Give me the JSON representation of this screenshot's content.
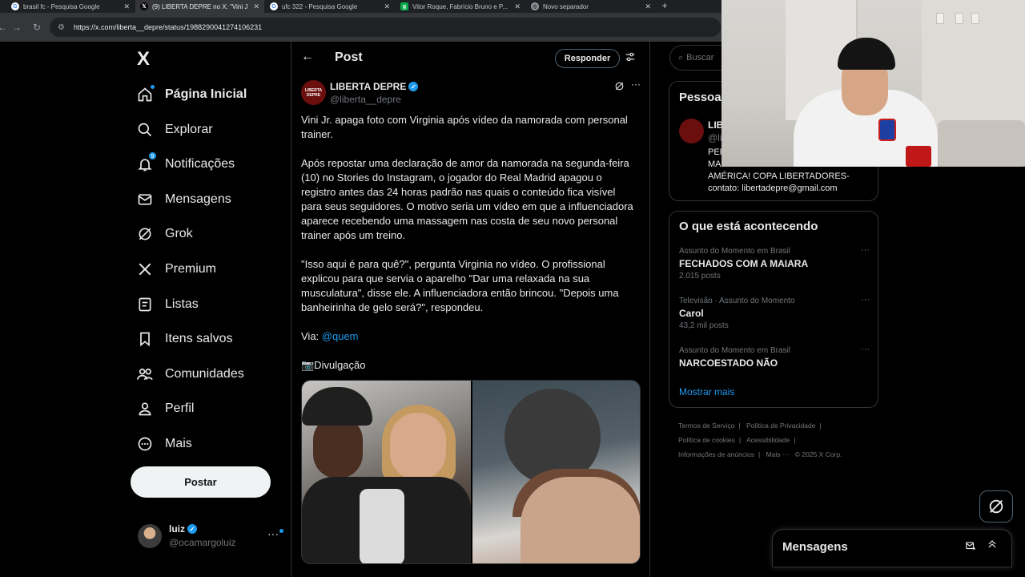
{
  "browser": {
    "tabs": [
      {
        "label": "brasil fc - Pesquisa Google",
        "icon": "google-icon",
        "active": false
      },
      {
        "label": "(9) LIBERTA DEPRE no X: \"Vini J...",
        "icon": "x-icon",
        "active": true
      },
      {
        "label": "ufc 322 - Pesquisa Google",
        "icon": "google-icon",
        "active": false
      },
      {
        "label": "Vitor Roque, Fabrício Bruno e P...",
        "icon": "ge-icon",
        "active": false
      },
      {
        "label": "Novo separador",
        "icon": "chrome-icon",
        "active": false
      }
    ],
    "new_tab": "+",
    "url": "https://x.com/liberta__depre/status/1988290041274106231"
  },
  "nav": {
    "logo": "X",
    "items": [
      {
        "label": "Página Inicial",
        "icon": "home-icon"
      },
      {
        "label": "Explorar",
        "icon": "search-icon"
      },
      {
        "label": "Notificações",
        "icon": "bell-icon",
        "badge": "9"
      },
      {
        "label": "Mensagens",
        "icon": "mail-icon"
      },
      {
        "label": "Grok",
        "icon": "grok-icon"
      },
      {
        "label": "Premium",
        "icon": "x-premium-icon"
      },
      {
        "label": "Listas",
        "icon": "list-icon"
      },
      {
        "label": "Itens salvos",
        "icon": "bookmark-icon"
      },
      {
        "label": "Comunidades",
        "icon": "communities-icon"
      },
      {
        "label": "Perfil",
        "icon": "person-icon"
      },
      {
        "label": "Mais",
        "icon": "more-circle-icon"
      }
    ],
    "post_button": "Postar"
  },
  "account": {
    "name": "luiz",
    "handle": "@ocamargoluiz",
    "more": "···"
  },
  "post": {
    "header_title": "Post",
    "reply_button": "Responder",
    "author_name": "LIBERTA DEPRE",
    "author_handle": "@liberta__depre",
    "avatar_text": "LIBERTA DEPRE",
    "paragraphs": [
      "Vini Jr. apaga foto com Virginia após vídeo da namorada com personal trainer.",
      "Após repostar uma declaração de amor da namorada na segunda-feira (10) no Stories do Instagram, o jogador do Real Madrid apagou o registro antes das 24 horas padrão nas quais o conteúdo fica visível para seus seguidores. O motivo seria um vídeo em que a influenciadora aparece recebendo uma massagem nas costa de seu novo personal trainer após um treino.",
      "\"Isso aqui é para quê?\", pergunta Virginia no vídeo. O profissional explicou para que servia o aparelho \"Dar uma relaxada na sua musculatura\", disse ele. A influenciadora então brincou. \"Depois uma banheirinha de gelo será?\", respondeu."
    ],
    "via_label": "Via: ",
    "via_link": "@quem",
    "credit": "📷Divulgação"
  },
  "sidebar": {
    "search_placeholder": "Buscar",
    "who_to_follow": {
      "title": "Pessoa",
      "name": "LIB",
      "handle": "@li",
      "bio_lines": [
        "PER",
        "MA",
        "AMÉRICA! COPA LIBERTADORES-",
        "contato: libertadepre@gmail.com"
      ]
    },
    "trends_title": "O que está acontecendo",
    "trends": [
      {
        "context": "Assunto do Momento em Brasil",
        "name": "FECHADOS COM A MAIARA",
        "count": "2.015 posts"
      },
      {
        "context": "Televisão · Assunto do Momento",
        "name": "Carol",
        "count": "43,2 mil posts"
      },
      {
        "context": "Assunto do Momento em Brasil",
        "name": "NARCOESTADO NÃO",
        "count": ""
      }
    ],
    "show_more": "Mostrar mais",
    "footer": [
      "Termos de Serviço",
      "|",
      "Política de Privacidade",
      "|",
      "Política de cookies",
      "|",
      "Acessibilidade",
      "|",
      "Informações de anúncios",
      "|",
      "Mais ···",
      "© 2025 X Corp."
    ]
  },
  "messages_drawer": {
    "title": "Mensagens"
  },
  "colors": {
    "accent": "#1d9bf0",
    "background": "#000000",
    "text": "#e7e9ea",
    "muted": "#71767b",
    "border": "#2f3336"
  }
}
